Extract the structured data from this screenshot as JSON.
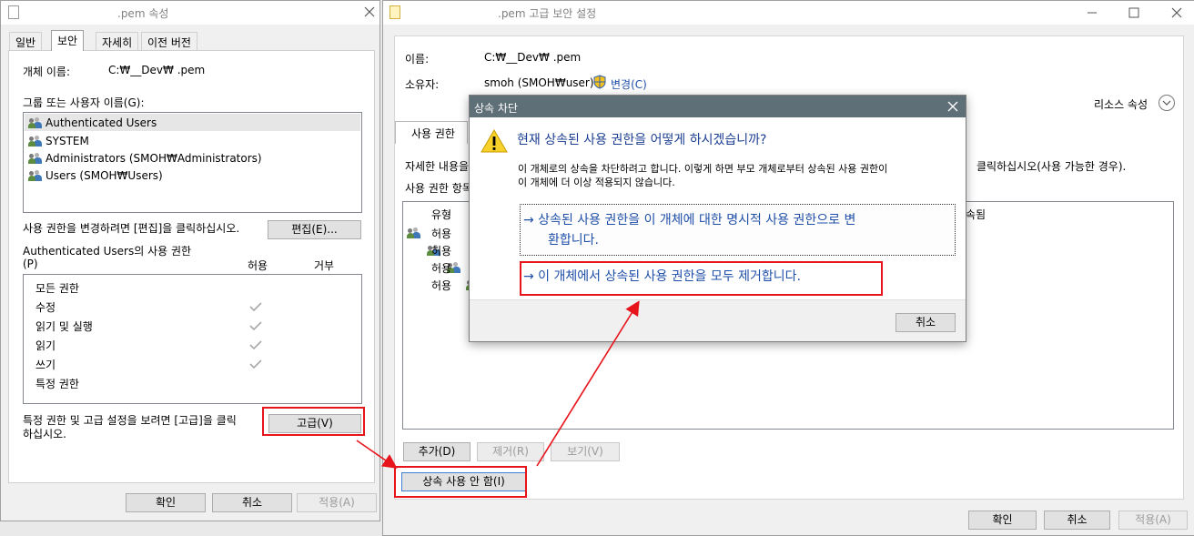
{
  "left_window": {
    "title": ".pem 속성",
    "tabs": [
      "일반",
      "보안",
      "자세히",
      "이전 버전"
    ],
    "active_tab": "보안",
    "object_name_label": "개체 이름:",
    "object_name_value": "C:₩__Dev₩                       .pem",
    "groups_label": "그룹 또는 사용자 이름(G):",
    "users": [
      "Authenticated Users",
      "SYSTEM",
      "Administrators (SMOH₩Administrators)",
      "Users (SMOH₩Users)"
    ],
    "edit_hint": "사용 권한을 변경하려면 [편집]을 클릭하십시오.",
    "edit_button": "편집(E)...",
    "perm_title": "Authenticated Users의 사용 권한",
    "perm_key": "(P)",
    "allow_header": "허용",
    "deny_header": "거부",
    "permissions": [
      {
        "name": "모든 권한",
        "allow": false
      },
      {
        "name": "수정",
        "allow": true
      },
      {
        "name": "읽기 및 실행",
        "allow": true
      },
      {
        "name": "읽기",
        "allow": true
      },
      {
        "name": "쓰기",
        "allow": true
      },
      {
        "name": "특정 권한",
        "allow": false
      }
    ],
    "advanced_hint_line1": "특정 권한 및 고급 설정을 보려면 [고급]을 클릭",
    "advanced_hint_line2": "하십시오.",
    "advanced_button": "고급(V)",
    "ok_button": "확인",
    "cancel_button": "취소",
    "apply_button": "적용(A)"
  },
  "right_window": {
    "title": ".pem 고급 보안 설정",
    "name_label": "이름:",
    "name_value": "C:₩__Dev₩                            .pem",
    "owner_label": "소유자:",
    "owner_value": "smoh (SMOH₩user)",
    "change_link": "변경(C)",
    "resource_props": "리소스 속성",
    "tab_permissions": "사용 권한",
    "detail_text_left": "자세한 내용을",
    "detail_text_right": "클릭하십시오(사용 가능한 경우).",
    "entries_label": "사용 권한 항목",
    "col_type": "유형",
    "col_inherited": "속됨",
    "entries": [
      "허용",
      "허용",
      "허용",
      "허용"
    ],
    "add_button": "추가(D)",
    "remove_button": "제거(R)",
    "view_button": "보기(V)",
    "disable_inheritance_button": "상속 사용 안 함(I)",
    "ok_button": "확인",
    "cancel_button": "취소",
    "apply_button": "적용(A)"
  },
  "dialog": {
    "title": "상속 차단",
    "heading": "현재 상속된 사용 권한을 어떻게 하시겠습니까?",
    "body_line1": "이 개체로의 상속을 차단하려고 합니다. 이렇게 하면 부모 개체로부터 상속된 사용 권한이",
    "body_line2": "이 개체에 더 이상 적용되지 않습니다.",
    "option1_line1": "→ 상속된 사용 권한을 이 개체에 대한 명시적 사용 권한으로 변",
    "option1_line2": "환합니다.",
    "option2": "→ 이 개체에서 상속된 사용 권한을 모두 제거합니다.",
    "cancel_button": "취소"
  },
  "colors": {
    "annotation_red": "#e8141b",
    "link_blue": "#1f4fa8",
    "dialog_titlebar": "#5f6f78"
  }
}
